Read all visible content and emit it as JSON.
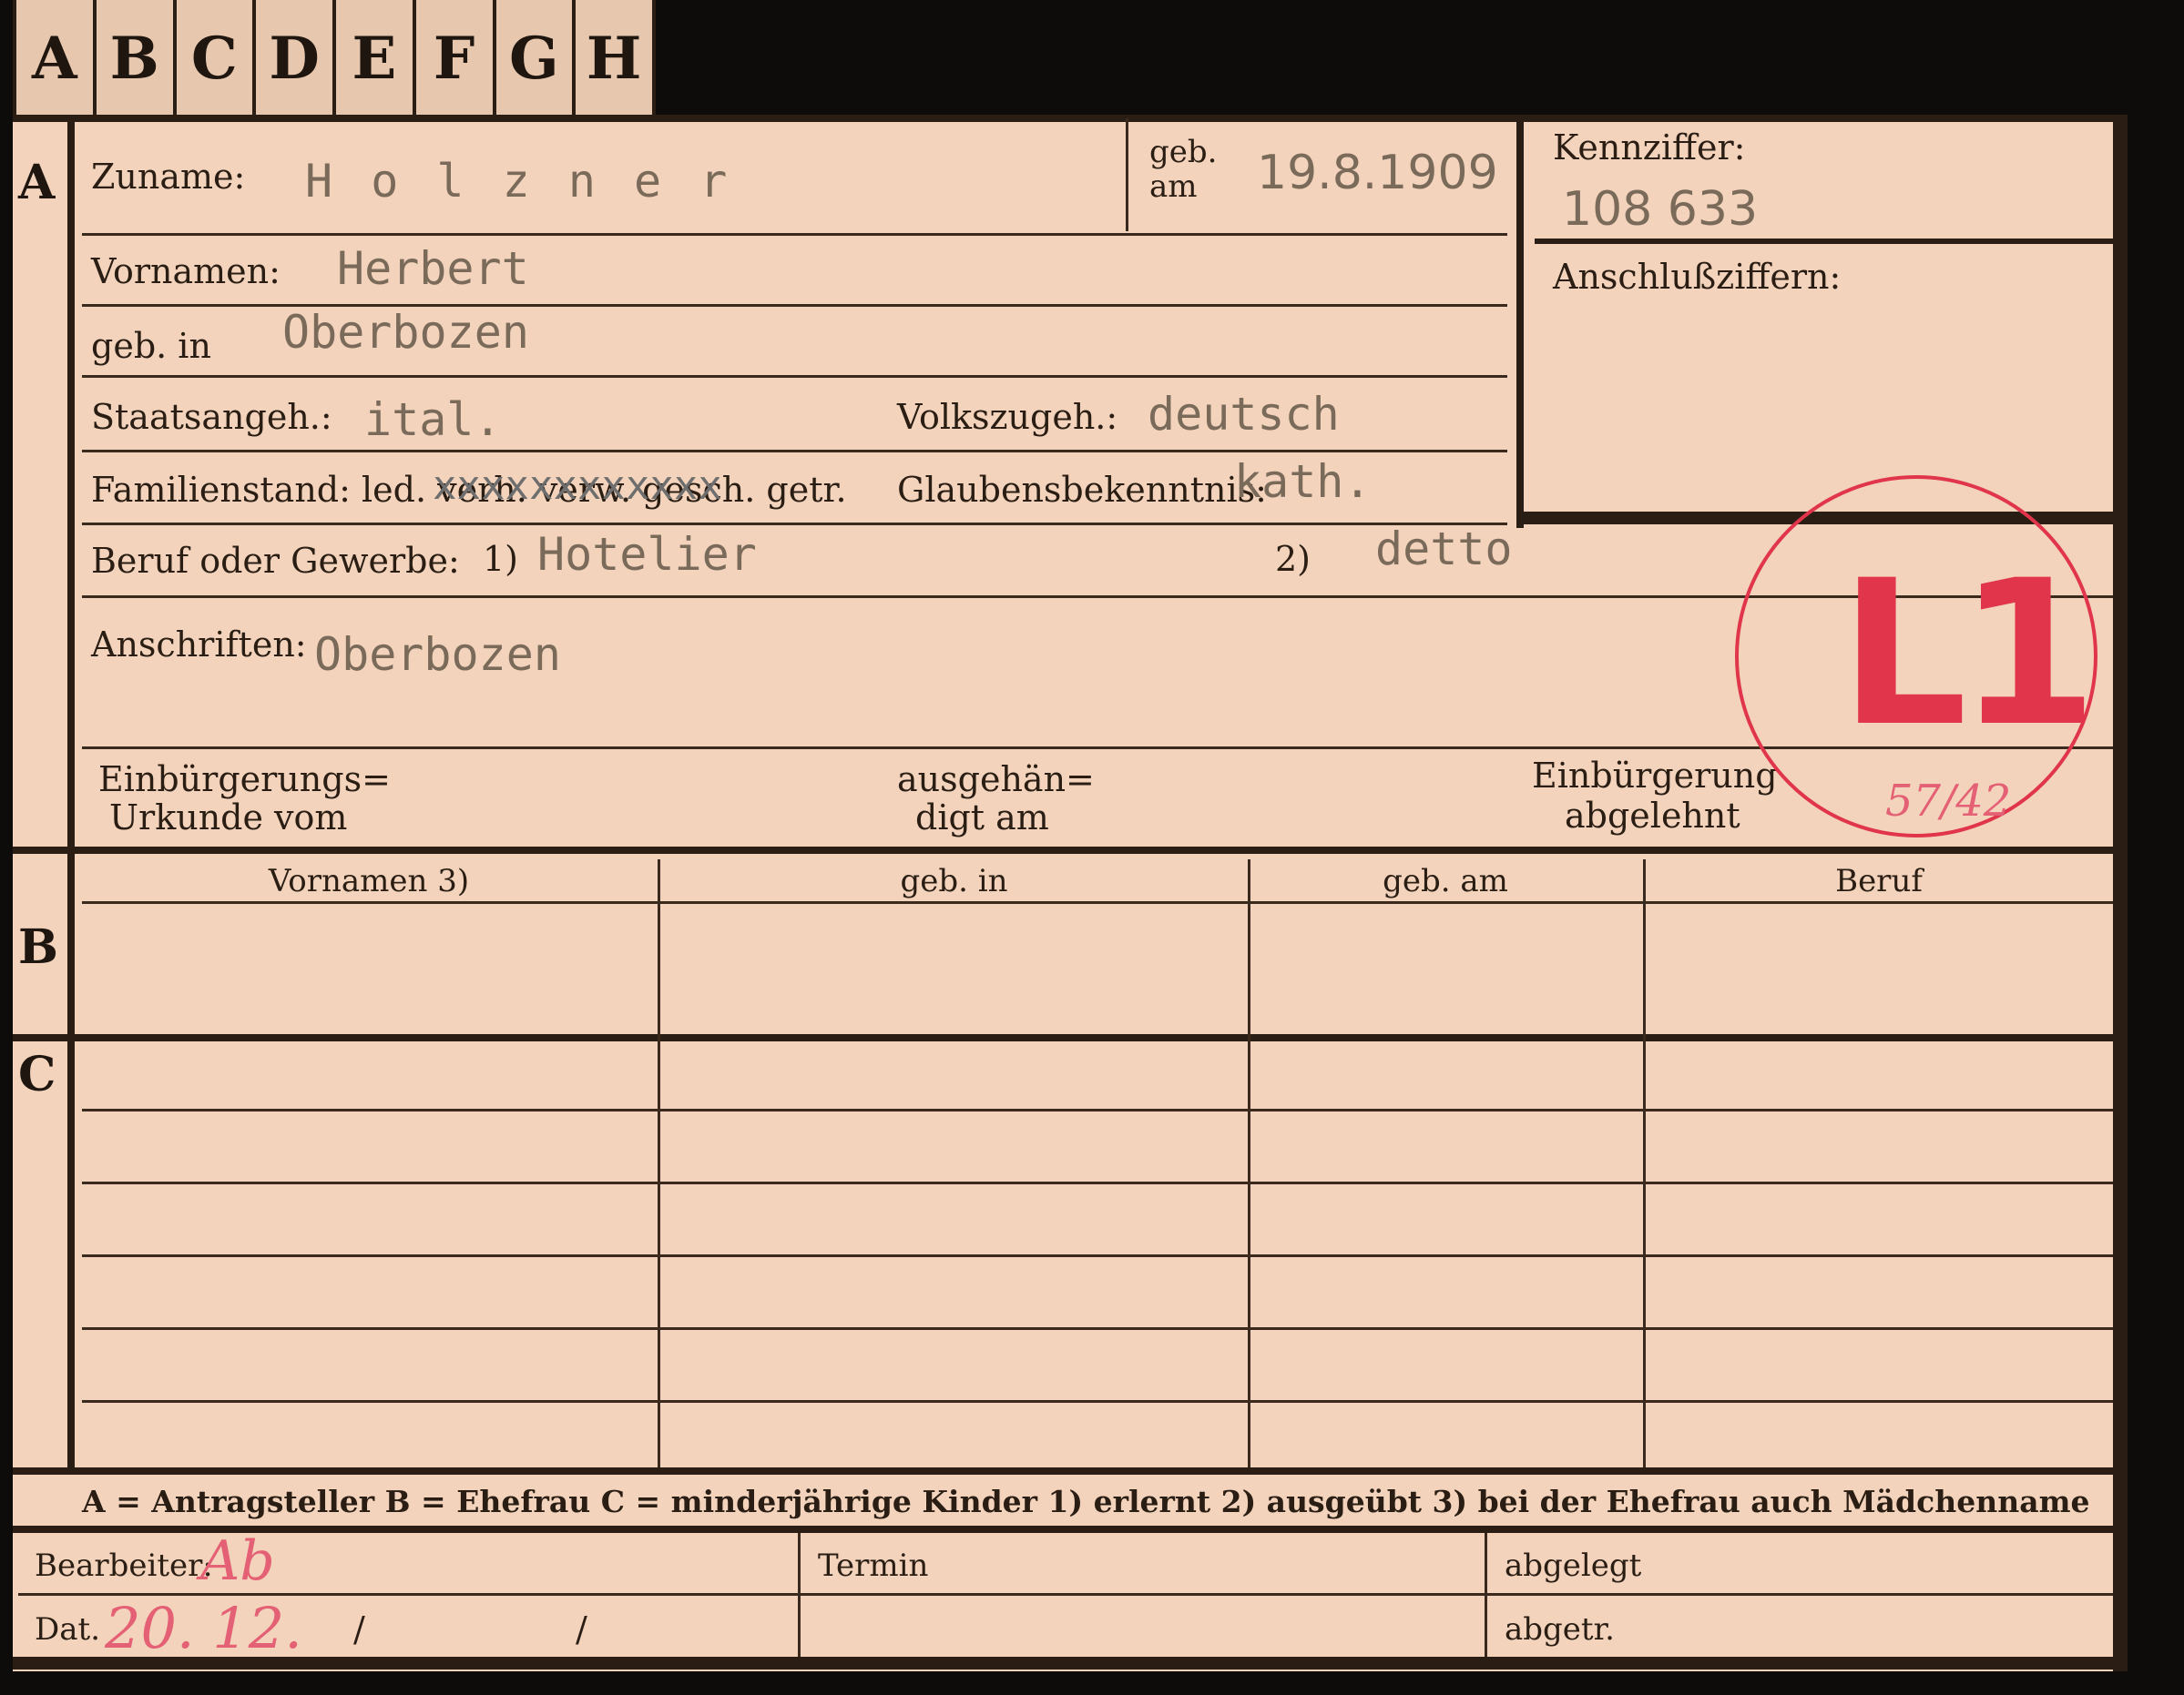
{
  "tabs": [
    "A",
    "B",
    "C",
    "D",
    "E",
    "F",
    "G",
    "H"
  ],
  "sections": {
    "a": "A",
    "b": "B",
    "c": "C"
  },
  "labels": {
    "zuname": "Zuname:",
    "geb_am": "geb. am",
    "kennziffer": "Kennziffer:",
    "anschlussziffern": "Anschlußziffern:",
    "vornamen": "Vornamen:",
    "geb_in": "geb. in",
    "staatsangeh": "Staatsangeh.:",
    "volkszugeh": "Volkszugeh.:",
    "familienstand": "Familienstand: led. verh. verw. gesch. getr.",
    "glaubensbekenntnis": "Glaubensbekenntnis:",
    "beruf": "Beruf oder Gewerbe:",
    "beruf_note1": "1)",
    "beruf_note2": "2)",
    "anschriften": "Anschriften:",
    "einbuergerungs": "Einbürgerungs=",
    "urkunde": "Urkunde vom",
    "ausgehaen": "ausgehän=",
    "digt": "digt am",
    "einbuergerung": "Einbürgerung",
    "abgelehnt": "abgelehnt"
  },
  "values": {
    "zuname": "H o l z n e r",
    "geb_am": "19.8.1909",
    "kennziffer": "108 633",
    "vornamen": "Herbert",
    "geb_in": "Oberbozen",
    "staatsangeh": "ital.",
    "volkszugeh": "deutsch",
    "familienstand_overtype": "xxxxxxxxxxxx",
    "glaubensbekenntnis": "kath.",
    "beruf_erlernt": "Hotelier",
    "beruf_ausgeuebt": "detto",
    "anschriften": "Oberbozen"
  },
  "stamp": {
    "code": "L1",
    "note": "57/42",
    "color": "#e0354a"
  },
  "table": {
    "headers": [
      "Vornamen 3)",
      "geb. in",
      "geb. am",
      "Beruf"
    ]
  },
  "legend": "A = Antragsteller   B = Ehefrau   C = minderjährige Kinder   1) erlernt   2) ausgeübt   3) bei der Ehefrau auch Mädchenname",
  "footer": {
    "bearbeiter": "Bearbeiter:",
    "bearbeiter_value": "Ab",
    "dat": "Dat.",
    "dat_value": "20. 12.",
    "dat_sep1": "/",
    "dat_sep2": "/",
    "termin": "Termin",
    "abgelegt": "abgelegt",
    "abgetr": "abgetr."
  }
}
